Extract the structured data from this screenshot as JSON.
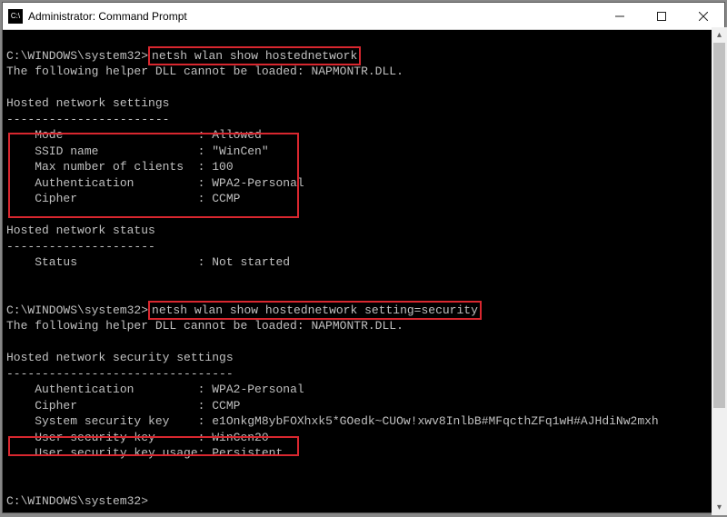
{
  "window": {
    "title": "Administrator: Command Prompt",
    "icon_label": "C:\\"
  },
  "term": {
    "prompt1_path": "C:\\WINDOWS\\system32>",
    "cmd1": "netsh wlan show hostednetwork",
    "dll_line": "The following helper DLL cannot be loaded: NAPMONTR.DLL.",
    "settings_header": "Hosted network settings",
    "dashes_short": "-----------------------",
    "mode_label": "    Mode                   : ",
    "mode_value": "Allowed",
    "ssid_label": "    SSID name              : ",
    "ssid_value": "\"WinCen\"",
    "max_label": "    Max number of clients  : ",
    "max_value": "100",
    "auth_label": "    Authentication         : ",
    "auth_value": "WPA2-Personal",
    "cipher_label": "    Cipher                 : ",
    "cipher_value": "CCMP",
    "status_header": "Hosted network status",
    "dashes_status": "---------------------",
    "status_label": "    Status                 : ",
    "status_value": "Not started",
    "cmd2": "netsh wlan show hostednetwork setting=security",
    "sec_header": "Hosted network security settings",
    "dashes_sec": "--------------------------------",
    "auth2_label": "    Authentication         : ",
    "auth2_value": "WPA2-Personal",
    "cipher2_label": "    Cipher                 : ",
    "cipher2_value": "CCMP",
    "syskey_label": "    System security key    : ",
    "syskey_value": "e1OnkgM8ybFOXhxk5*GOedk~CUOw!xwv8InlbB#MFqcthZFq1wH#AJHdiNw2mxh",
    "userkey_label": "    User security key      : ",
    "userkey_value": "WinCen20",
    "usage_label": "    User security key usage: ",
    "usage_value": "Persistent",
    "prompt2_path": "C:\\WINDOWS\\system32>"
  }
}
